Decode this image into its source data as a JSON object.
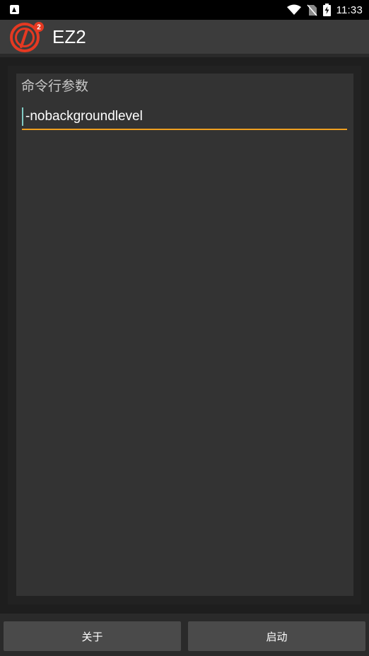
{
  "status_bar": {
    "time": "11:33",
    "icons": [
      "app-notification-icon",
      "wifi-icon",
      "no-sim-icon",
      "battery-charging-icon"
    ]
  },
  "app_bar": {
    "title": "EZ2",
    "logo": "ez2-logo",
    "logo_badge": "2",
    "accent_color": "#e53922"
  },
  "main": {
    "field_label": "命令行参数",
    "input_value": "-nobackgroundlevel",
    "underline_color": "#f0a020",
    "caret_color": "#80cbc4"
  },
  "buttons": {
    "about_label": "关于",
    "start_label": "启动"
  }
}
